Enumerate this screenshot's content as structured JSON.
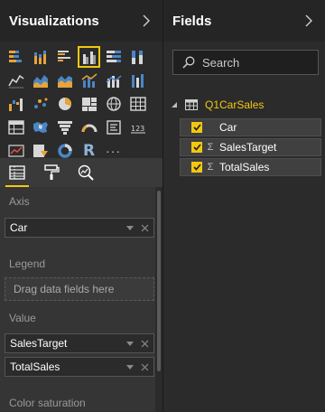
{
  "visualizations": {
    "title": "Visualizations",
    "icons": [
      [
        "stacked-bar-icon",
        "stacked-column-icon",
        "clustered-bar-icon",
        "clustered-column-icon",
        "100-stacked-bar-icon",
        "100-stacked-column-icon"
      ],
      [
        "line-chart-icon",
        "area-chart-icon",
        "stacked-area-icon",
        "line-clustered-column-icon",
        "line-stacked-column-icon",
        "ribbon-chart-icon"
      ],
      [
        "waterfall-icon",
        "scatter-chart-icon",
        "pie-chart-icon",
        "treemap-icon",
        "globe-map-icon",
        "table-icon"
      ],
      [
        "matrix-icon",
        "filled-map-icon",
        "funnel-icon",
        "gauge-icon",
        "card-icon",
        "multi-row-card-icon"
      ],
      [
        "kpi-icon",
        "slicer-icon",
        "donut-icon",
        "r-script-icon",
        "more-icon"
      ]
    ],
    "selected_icon": "clustered-column-icon",
    "r_label": "R",
    "more_label": "···",
    "tabs": [
      "fields-tab",
      "format-tab",
      "analytics-tab"
    ],
    "active_tab": "fields-tab",
    "wells": {
      "axis": {
        "label": "Axis",
        "field": "Car"
      },
      "legend": {
        "label": "Legend",
        "placeholder": "Drag data fields here"
      },
      "value": {
        "label": "Value",
        "fields": [
          "SalesTarget",
          "TotalSales"
        ]
      },
      "color_saturation": {
        "label": "Color saturation"
      }
    }
  },
  "fields": {
    "title": "Fields",
    "search_placeholder": "Search",
    "table": {
      "name": "Q1CarSales",
      "items": [
        {
          "name": "Car",
          "checked": true,
          "is_measure": false
        },
        {
          "name": "SalesTarget",
          "checked": true,
          "is_measure": true
        },
        {
          "name": "TotalSales",
          "checked": true,
          "is_measure": true
        }
      ]
    }
  },
  "colors": {
    "accent": "#f2c80f",
    "background": "#2b2b2b",
    "header": "#252525",
    "well_background": "#353535"
  }
}
